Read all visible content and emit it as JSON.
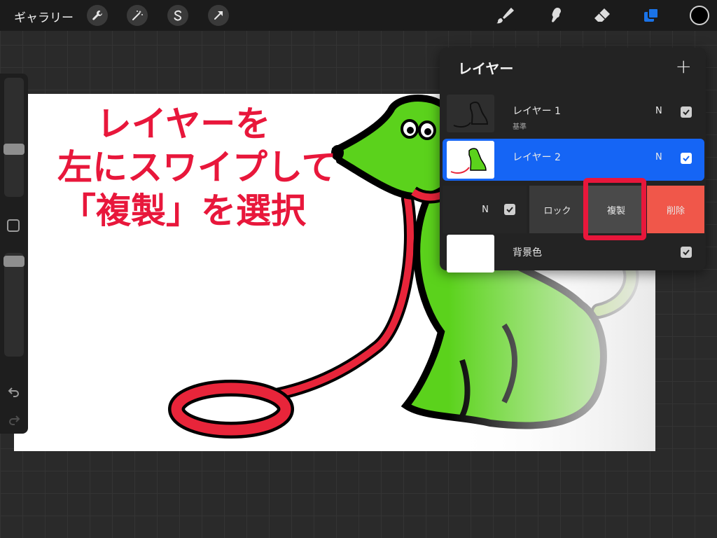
{
  "toolbar": {
    "gallery_label": "ギャラリー",
    "left_buttons": [
      "wrench-icon",
      "magic-wand-icon",
      "selection-s-icon",
      "transform-arrow-icon"
    ],
    "right_tools": [
      "brush-icon",
      "smudge-icon",
      "eraser-icon",
      "layers-icon"
    ],
    "color_well": "#000000",
    "layers_active_color": "#1a73e8"
  },
  "sidebar": {
    "controls": [
      "brush-size-slider",
      "modify-button",
      "opacity-slider",
      "undo-icon",
      "redo-icon"
    ]
  },
  "canvas": {
    "instruction_lines": [
      "レイヤーを",
      "左にスワイプして",
      "「複製」を選択"
    ],
    "instruction_color": "#e8173b"
  },
  "layers_panel": {
    "title": "レイヤー",
    "add_symbol": "+",
    "layers": [
      {
        "name": "レイヤー 1",
        "subtitle": "基準",
        "blend": "N",
        "visible": true,
        "selected": false
      },
      {
        "name": "レイヤー 2",
        "subtitle": "",
        "blend": "N",
        "visible": true,
        "selected": true
      }
    ],
    "swipe_actions": {
      "blend": "N",
      "lock": "ロック",
      "duplicate": "複製",
      "delete": "削除",
      "delete_color": "#f0574a"
    },
    "background": {
      "name": "背景色",
      "visible": true,
      "color": "#ffffff"
    }
  }
}
